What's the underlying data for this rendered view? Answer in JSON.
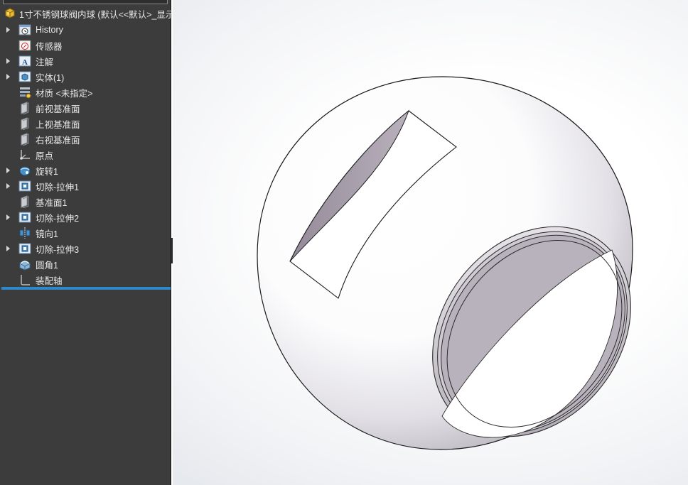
{
  "feature_tree": {
    "root": {
      "label": "1寸不锈钢球阀内球 (默认<<默认>_显示",
      "icon": "part-icon"
    },
    "items": [
      {
        "label": "History",
        "icon": "history-icon",
        "expandable": true
      },
      {
        "label": "传感器",
        "icon": "sensor-icon",
        "expandable": false
      },
      {
        "label": "注解",
        "icon": "annotation-icon",
        "expandable": true
      },
      {
        "label": "实体(1)",
        "icon": "solid-bodies-icon",
        "expandable": true
      },
      {
        "label": "材质 <未指定>",
        "icon": "material-icon",
        "expandable": false
      },
      {
        "label": "前视基准面",
        "icon": "plane-icon",
        "expandable": false
      },
      {
        "label": "上视基准面",
        "icon": "plane-icon",
        "expandable": false
      },
      {
        "label": "右视基准面",
        "icon": "plane-icon",
        "expandable": false
      },
      {
        "label": "原点",
        "icon": "origin-icon",
        "expandable": false
      },
      {
        "label": "旋转1",
        "icon": "revolve-icon",
        "expandable": true
      },
      {
        "label": "切除-拉伸1",
        "icon": "cut-extrude-icon",
        "expandable": true
      },
      {
        "label": "基准面1",
        "icon": "plane-icon",
        "expandable": false
      },
      {
        "label": "切除-拉伸2",
        "icon": "cut-extrude-icon",
        "expandable": true
      },
      {
        "label": "镜向1",
        "icon": "mirror-icon",
        "expandable": false
      },
      {
        "label": "切除-拉伸3",
        "icon": "cut-extrude-icon",
        "expandable": true
      },
      {
        "label": "圆角1",
        "icon": "fillet-icon",
        "expandable": false
      },
      {
        "label": "装配轴",
        "icon": "sketch-icon",
        "expandable": false
      }
    ]
  },
  "colors": {
    "panel_bg": "#3c3c3c",
    "panel_text": "#e8e8e8",
    "rollback_bar": "#2f88c9",
    "slot_shadow": "#a59ba8"
  }
}
